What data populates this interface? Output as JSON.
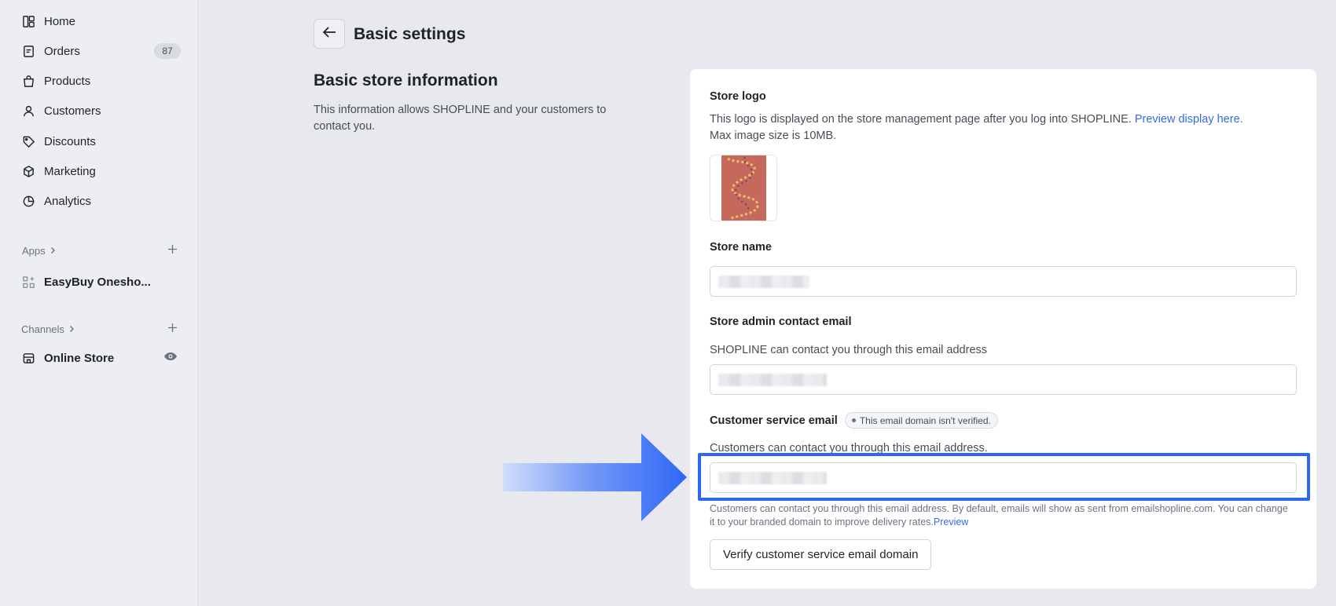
{
  "sidebar": {
    "items": [
      {
        "label": "Home",
        "icon": "home-icon"
      },
      {
        "label": "Orders",
        "icon": "orders-icon"
      },
      {
        "label": "Products",
        "icon": "products-icon"
      },
      {
        "label": "Customers",
        "icon": "customers-icon"
      },
      {
        "label": "Discounts",
        "icon": "discounts-icon"
      },
      {
        "label": "Marketing",
        "icon": "marketing-icon"
      },
      {
        "label": "Analytics",
        "icon": "analytics-icon"
      }
    ],
    "orders_badge": "87",
    "apps_heading": "Apps",
    "apps": [
      {
        "label": "EasyBuy Onesho...",
        "icon": "app-grid-icon"
      }
    ],
    "channels_heading": "Channels",
    "channels": [
      {
        "label": "Online Store",
        "icon": "store-icon"
      }
    ]
  },
  "header": {
    "title": "Basic settings"
  },
  "section": {
    "title": "Basic store information",
    "description": "This information allows SHOPLINE and your customers to contact you."
  },
  "card": {
    "logo_label": "Store logo",
    "logo_desc_prefix": "This logo is displayed on the store management page after you log into SHOPLINE. ",
    "logo_desc_link": "Preview display here.",
    "logo_desc_suffix": " Max image size is 10MB.",
    "store_name_label": "Store name",
    "admin_email_label": "Store admin contact email",
    "admin_email_desc": "SHOPLINE can contact you through this email address",
    "cs_email_label": "Customer service email",
    "cs_email_badge": "This email domain isn't verified.",
    "cs_email_desc": "Customers can contact you through this email address.",
    "cs_email_hint": "Customers can contact you through this email address. By default, emails will show as sent from emailshopline.com. You can change it to your branded domain to improve delivery rates.",
    "cs_email_hint_link": "Preview",
    "verify_button": "Verify customer service email domain"
  },
  "colors": {
    "accent": "#2f67f5",
    "link": "#356ae6"
  }
}
